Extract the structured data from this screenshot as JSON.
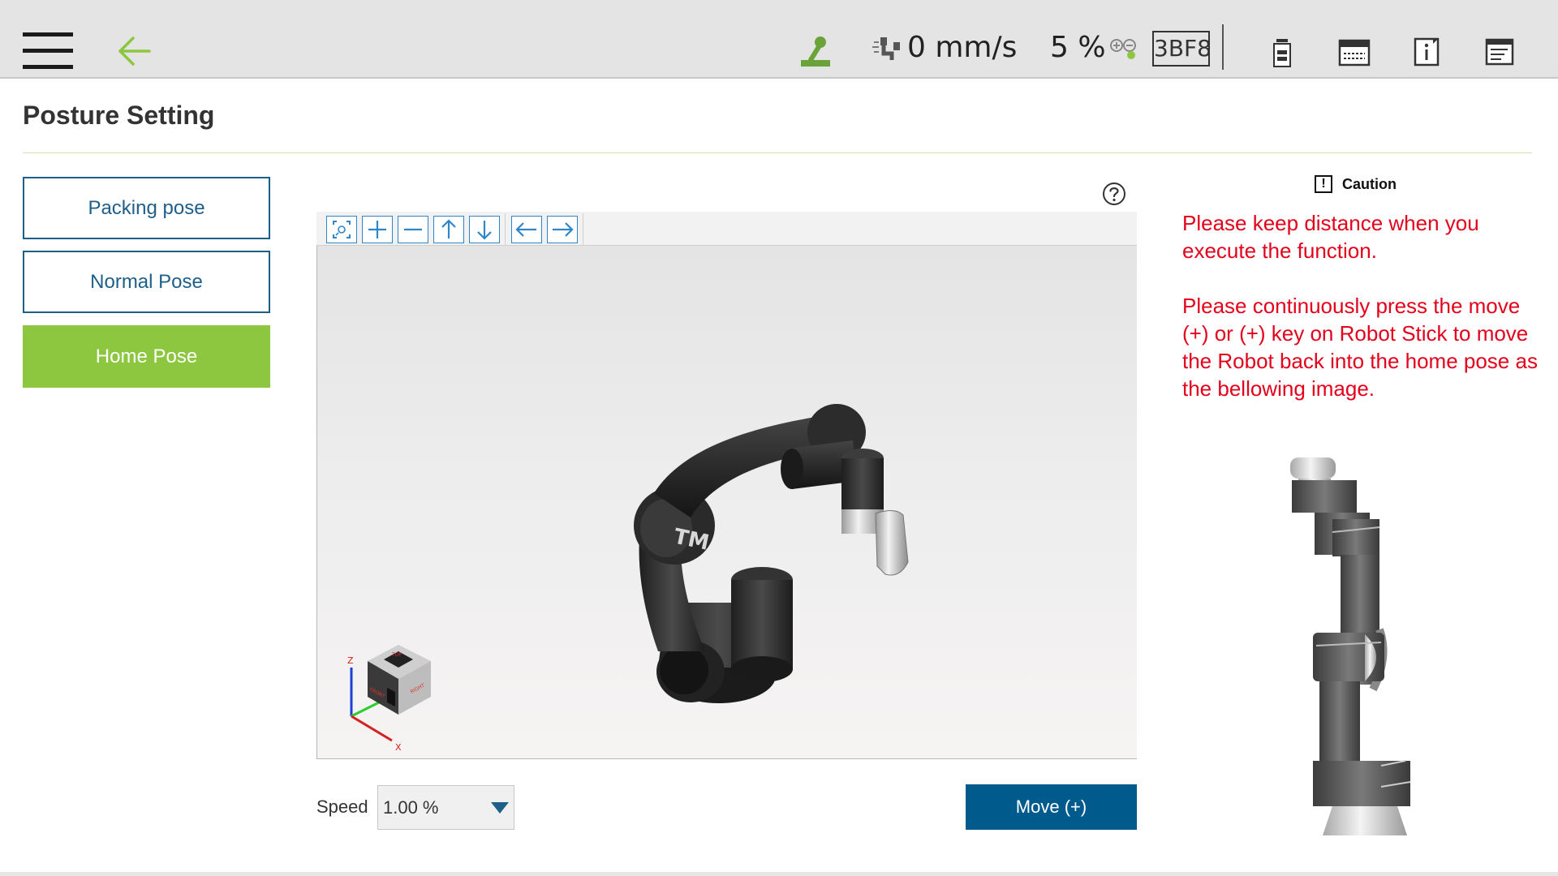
{
  "topbar": {
    "speed_value": "0 mm/s",
    "speed_percent": "5 %",
    "device_code": "3BF8",
    "icons": [
      "menu-icon",
      "back-arrow-icon",
      "joystick-icon",
      "robot-speed-icon",
      "link-status-icon",
      "battery-icon",
      "keyboard-icon",
      "info-icon",
      "notes-icon"
    ]
  },
  "page": {
    "title": "Posture Setting"
  },
  "poses": [
    {
      "label": "Packing pose",
      "active": false
    },
    {
      "label": "Normal Pose",
      "active": false
    },
    {
      "label": "Home Pose",
      "active": true
    }
  ],
  "viewer": {
    "toolbar_icons": [
      "fit-view-icon",
      "zoom-in-icon",
      "zoom-out-icon",
      "arrow-up-icon",
      "arrow-down-icon",
      "arrow-left-icon",
      "arrow-right-icon"
    ],
    "view_cube": {
      "top": "TOP",
      "front": "FRONT",
      "right": "RIGHT"
    },
    "axes": {
      "x": "X",
      "y": "Y",
      "z": "Z"
    },
    "robot_logo": "TM"
  },
  "controls": {
    "speed_label": "Speed",
    "speed_value": "1.00 %",
    "move_button": "Move (+)"
  },
  "caution": {
    "title": "Caution",
    "line1": "Please keep distance when you execute the function.",
    "line2": "Please continuously press the move (+) or (+) key on Robot Stick to move the Robot back into the home pose as the bellowing image."
  },
  "colors": {
    "accent_green": "#8dc63f",
    "primary_blue": "#005a8c",
    "caution_red": "#e4001b",
    "topbar_gray": "#e4e4e4"
  }
}
